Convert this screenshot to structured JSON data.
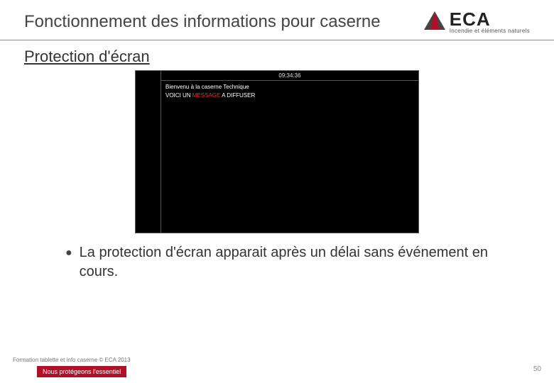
{
  "header": {
    "title": "Fonctionnement des informations pour caserne",
    "logo_main": "ECA",
    "logo_sub": "Incendie et éléments naturels"
  },
  "section": {
    "title": "Protection d'écran"
  },
  "screenshot": {
    "clock": "09:34:36",
    "line1": "Bienvenu à la caserne Technique",
    "line2_a": "VOICI UN ",
    "line2_hl": "MESSAGE",
    "line2_b": " A DIFFUSER"
  },
  "bullet": {
    "text": "La protection d'écran apparait après un délai sans événement en cours."
  },
  "footer": {
    "left": "Formation tablette et info caserne © ECA 2013",
    "tag": "Nous protégeons l'essentiel",
    "page": "50"
  }
}
